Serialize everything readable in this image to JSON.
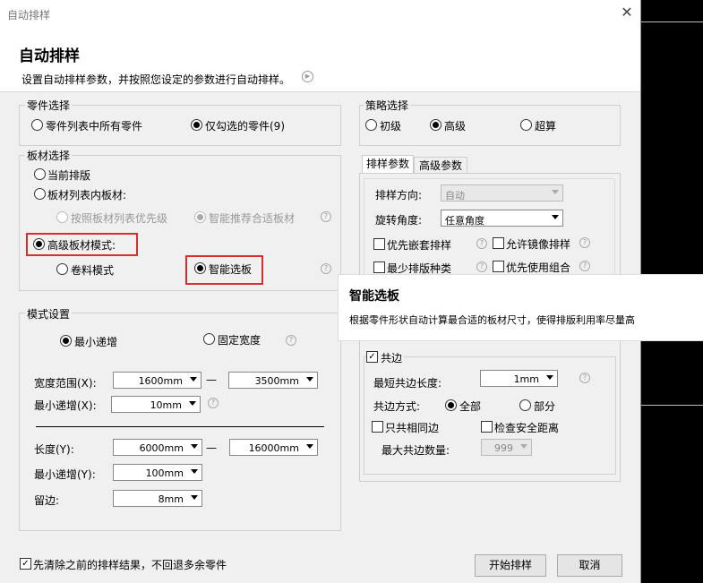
{
  "window": {
    "title": "自动排样"
  },
  "header": {
    "title": "自动排样",
    "subtitle": "设置自动排样参数，并按照您设定的参数进行自动排样。"
  },
  "parts": {
    "title": "零件选择",
    "opt_all": "零件列表中所有零件",
    "opt_checked": "仅勾选的零件(9)",
    "selected": "opt_checked"
  },
  "plate": {
    "title": "板材选择",
    "opt_current": "当前排版",
    "opt_list": "板材列表内板材:",
    "sub_priority": "按照板材列表优先级",
    "sub_smart": "智能推荐合适板材",
    "opt_advanced": "高级板材模式:",
    "adv_coil": "卷料模式",
    "adv_smart": "智能选板"
  },
  "mode": {
    "title": "模式设置",
    "opt_min": "最小递增",
    "opt_fixed": "固定宽度",
    "width_label": "宽度范围(X):",
    "width_from": "1600mm",
    "width_to": "3500mm",
    "minx_label": "最小递增(X):",
    "minx_value": "10mm",
    "length_label": "长度(Y):",
    "length_from": "6000mm",
    "length_to": "16000mm",
    "miny_label": "最小递增(Y):",
    "miny_value": "100mm",
    "margin_label": "留边:",
    "margin_value": "8mm",
    "dash": "—"
  },
  "strategy": {
    "title": "策略选择",
    "opt_basic": "初级",
    "opt_advanced": "高级",
    "opt_super": "超算"
  },
  "tabs": {
    "nest": "排样参数",
    "advanced": "高级参数"
  },
  "nest_params": {
    "direction_label": "排样方向:",
    "direction_value": "自动",
    "rotation_label": "旋转角度:",
    "rotation_value": "任意角度",
    "chk_nested": "优先嵌套排样",
    "chk_mirror": "允许镜像排样",
    "chk_min_types": "最少排版种类",
    "chk_combo": "优先使用组合"
  },
  "tooltip": {
    "title": "智能选板",
    "desc": "根据零件形状自动计算最合适的板材尺寸，使得排版利用率尽量高"
  },
  "common_edge": {
    "title": "共边",
    "min_len_label": "最短共边长度:",
    "min_len_value": "1mm",
    "mode_label": "共边方式:",
    "opt_all": "全部",
    "opt_part": "部分",
    "chk_same": "只共相同边",
    "chk_safe": "检查安全距离",
    "max_label": "最大共边数量:",
    "max_value": "999"
  },
  "footer": {
    "clear_label": "先清除之前的排样结果，不回退多余零件",
    "start": "开始排样",
    "cancel": "取消"
  },
  "icons": {
    "close": "close-icon",
    "help": "help-icon",
    "play": "play-icon"
  },
  "colors": {
    "highlight": "#d32f2f"
  }
}
